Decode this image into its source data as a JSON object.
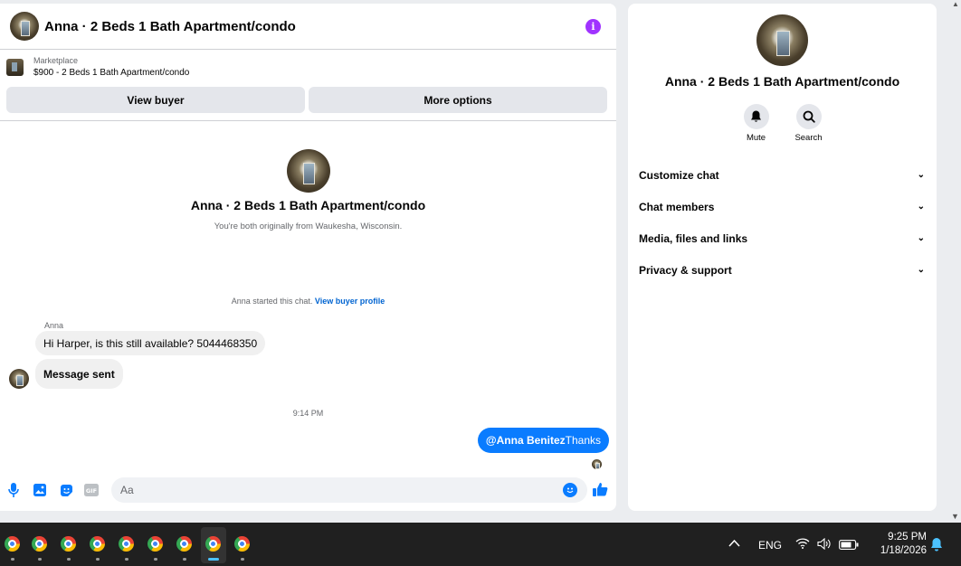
{
  "chat": {
    "title": "Anna · 2 Beds 1 Bath Apartment/condo",
    "info_icon": "info-icon",
    "listing": {
      "label": "Marketplace",
      "price_title": "$900 - 2 Beds 1 Bath Apartment/condo"
    },
    "buttons": {
      "view_buyer": "View buyer",
      "more_options": "More options"
    },
    "intro": {
      "name": "Anna · 2 Beds 1 Bath Apartment/condo",
      "subtitle": "You're both originally from Waukesha, Wisconsin."
    },
    "system": {
      "text": "Anna started this chat.",
      "link": "View buyer profile"
    },
    "messages": {
      "sender": "Anna",
      "in_1": "Hi Harper, is this still available? 5044468350",
      "in_2": "Message sent",
      "time": "9:14 PM",
      "out_mention": "@Anna Benitez",
      "out_text": "Thanks"
    },
    "composer": {
      "placeholder": "Aa"
    },
    "colors": {
      "accent": "#0a7cff",
      "info": "#a033ff"
    }
  },
  "info_panel": {
    "name": "Anna · 2 Beds 1 Bath Apartment/condo",
    "actions": [
      {
        "label": "Mute",
        "icon": "bell-icon"
      },
      {
        "label": "Search",
        "icon": "search-icon"
      }
    ],
    "sections": [
      "Customize chat",
      "Chat members",
      "Media, files and links",
      "Privacy & support"
    ]
  },
  "taskbar": {
    "apps": [
      "chrome-icon",
      "chrome-icon",
      "chrome-icon",
      "chrome-icon",
      "chrome-icon",
      "chrome-icon",
      "chrome-icon",
      "chrome-icon",
      "chrome-icon"
    ],
    "active_index": 7,
    "lang": "ENG",
    "time": "9:25 PM",
    "date": "1/18/2026"
  }
}
